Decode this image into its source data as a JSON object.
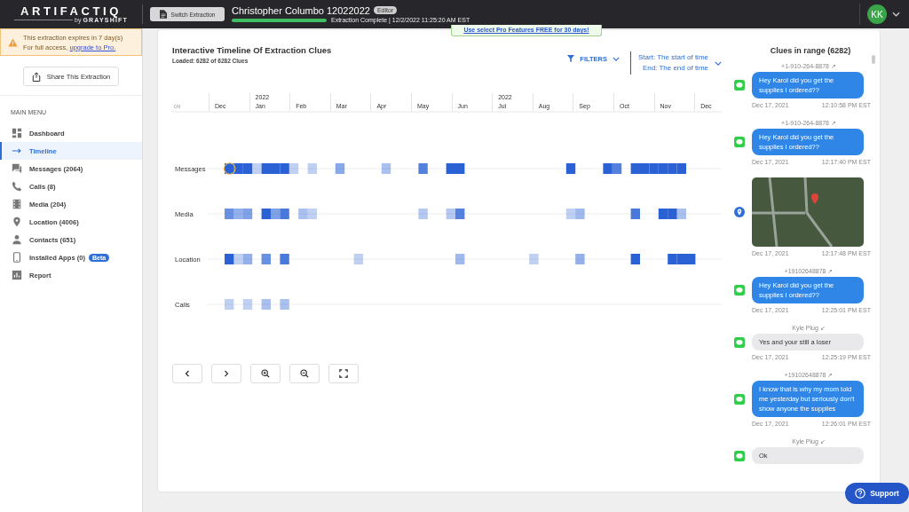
{
  "topbar": {
    "logo": "ARTIFACTIQ",
    "logo_by": "by",
    "logo_sub": "GRAYSHIFT",
    "switch_button": "Switch Extraction",
    "title": "Christopher Columbo 12022022",
    "badge": "Editor",
    "progress": {
      "level": 1
    },
    "status": "Extraction Complete | 12/2/2022 11:25:20 AM EST",
    "avatar": "KK"
  },
  "promo": "Use select Pro Features FREE for 30 days!",
  "sidebar": {
    "notice": {
      "line1": "This extraction expires in 7 day(s)",
      "line2": "For full access,",
      "link": "upgrade to Pro."
    },
    "share_button": "Share This Extraction",
    "menu_title": "MAIN MENU",
    "items": [
      {
        "label": "Dashboard",
        "selected": false
      },
      {
        "label": "Timeline",
        "selected": true
      },
      {
        "label": "Messages (2064)",
        "selected": false
      },
      {
        "label": "Calls (8)",
        "selected": false
      },
      {
        "label": "Media (204)",
        "selected": false
      },
      {
        "label": "Location (4006)",
        "selected": false
      },
      {
        "label": "Contacts (651)",
        "selected": false
      },
      {
        "label": "Installed Apps (0)",
        "selected": false,
        "badge": "Beta"
      },
      {
        "label": "Report",
        "selected": false
      }
    ]
  },
  "timeline": {
    "title": "Interactive Timeline Of Extraction Clues",
    "subtitle": "Loaded: 6282 of 6282 Clues",
    "filters": "FILTERS",
    "start": "Start: The start of time",
    "end": "End: The end of time",
    "months": [
      {
        "label": "ov"
      },
      {
        "label": "Dec"
      },
      {
        "label": "Jan",
        "year": "2022"
      },
      {
        "label": "Feb"
      },
      {
        "label": "Mar"
      },
      {
        "label": "Apr"
      },
      {
        "label": "May"
      },
      {
        "label": "Jun"
      },
      {
        "label": "Jul",
        "year": "2022"
      },
      {
        "label": "Aug"
      },
      {
        "label": "Sep"
      },
      {
        "label": "Oct"
      },
      {
        "label": "Nov"
      },
      {
        "label": "Dec"
      }
    ],
    "rows": [
      {
        "label": "Messages"
      },
      {
        "label": "Media"
      },
      {
        "label": "Location"
      },
      {
        "label": "Calls"
      }
    ]
  },
  "clues": {
    "title": "Clues in range (6282)",
    "items": [
      {
        "kind": "sent",
        "sender": "+1-910-264-8878",
        "arrow": "↗",
        "text": "Hey Karol did you get the supplies I ordered??",
        "date": "Dec 17, 2021",
        "time": "12:10:58 PM EST"
      },
      {
        "kind": "sent",
        "sender": "+1-910-264-8878",
        "arrow": "↗",
        "text": "Hey Karol did you get the supplies I ordered??",
        "date": "Dec 17, 2021",
        "time": "12:17:40 PM EST"
      },
      {
        "kind": "location",
        "date": "Dec 17, 2021",
        "time": "12:17:48 PM EST"
      },
      {
        "kind": "sent",
        "sender": "+19102648878",
        "arrow": "↗",
        "text": "Hey Karol did you get the supplies I ordered??",
        "date": "Dec 17, 2021",
        "time": "12:25:01 PM EST"
      },
      {
        "kind": "received",
        "sender": "Kyle Plug",
        "arrow": "↙",
        "text": "Yes and your still a loser",
        "date": "Dec 17, 2021",
        "time": "12:25:19 PM EST"
      },
      {
        "kind": "sent",
        "sender": "+19102648878",
        "arrow": "↗",
        "text": "I know that is why my mom told me yesterday but seriously don't show anyone the supplies",
        "date": "Dec 17, 2021",
        "time": "12:26:01 PM EST"
      },
      {
        "kind": "received",
        "sender": "Kyle Plug",
        "arrow": "↙",
        "text": "Ok"
      }
    ]
  },
  "support": "Support"
}
